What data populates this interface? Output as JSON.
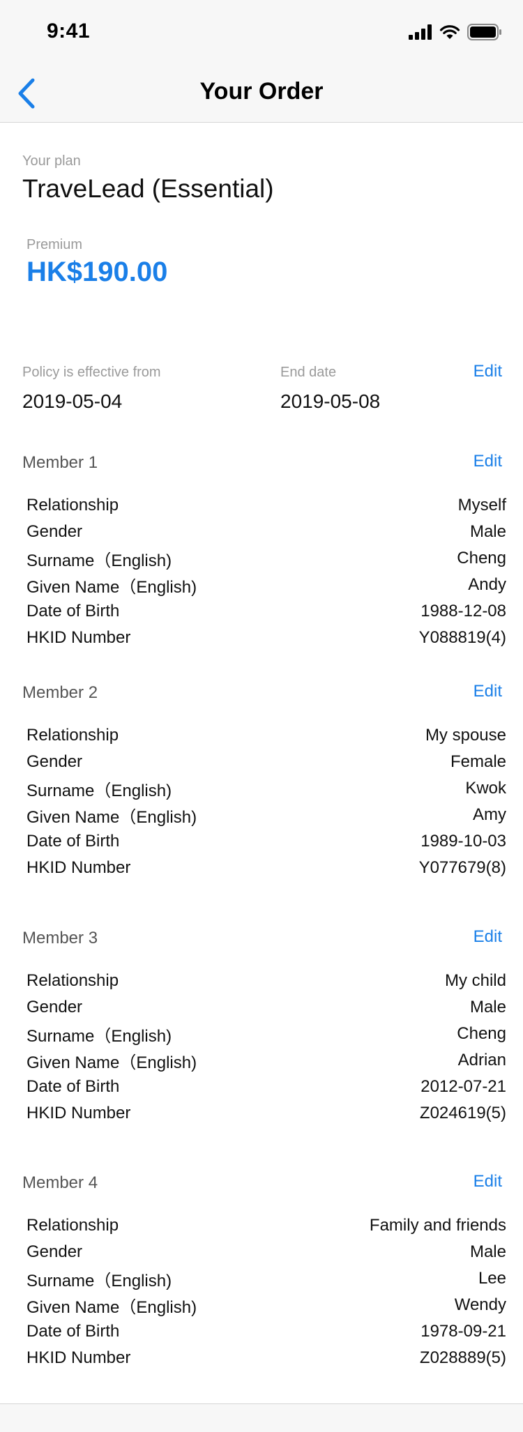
{
  "status_bar": {
    "time": "9:41"
  },
  "nav": {
    "title": "Your Order"
  },
  "plan": {
    "label": "Your plan",
    "name": "TraveLead (Essential)"
  },
  "premium": {
    "label": "Premium",
    "amount": "HK$190.00"
  },
  "dates": {
    "effective_label": "Policy is effective from",
    "effective_value": "2019-05-04",
    "end_label": "End date",
    "end_value": "2019-05-08",
    "edit_label": "Edit"
  },
  "members": [
    {
      "title": "Member 1",
      "edit": "Edit",
      "rows": [
        {
          "label": "Relationship",
          "value": "Myself"
        },
        {
          "label": "Gender",
          "value": "Male"
        },
        {
          "label": "Surname（English)",
          "value": "Cheng"
        },
        {
          "label": "Given Name（English)",
          "value": "Andy"
        },
        {
          "label": "Date of Birth",
          "value": "1988-12-08"
        },
        {
          "label": "HKID Number",
          "value": "Y088819(4)"
        }
      ]
    },
    {
      "title": "Member 2",
      "edit": "Edit",
      "rows": [
        {
          "label": "Relationship",
          "value": "My spouse"
        },
        {
          "label": "Gender",
          "value": "Female"
        },
        {
          "label": "Surname（English)",
          "value": "Kwok"
        },
        {
          "label": "Given Name（English)",
          "value": "Amy"
        },
        {
          "label": "Date of Birth",
          "value": "1989-10-03"
        },
        {
          "label": "HKID Number",
          "value": "Y077679(8)"
        }
      ]
    },
    {
      "title": "Member 3",
      "edit": "Edit",
      "rows": [
        {
          "label": "Relationship",
          "value": "My child"
        },
        {
          "label": "Gender",
          "value": "Male"
        },
        {
          "label": "Surname（English)",
          "value": "Cheng"
        },
        {
          "label": "Given Name（English)",
          "value": "Adrian"
        },
        {
          "label": "Date of Birth",
          "value": "2012-07-21"
        },
        {
          "label": "HKID Number",
          "value": "Z024619(5)"
        }
      ]
    },
    {
      "title": "Member 4",
      "edit": "Edit",
      "rows": [
        {
          "label": "Relationship",
          "value": "Family and friends"
        },
        {
          "label": "Gender",
          "value": "Male"
        },
        {
          "label": "Surname（English)",
          "value": "Lee"
        },
        {
          "label": "Given Name（English)",
          "value": "Wendy"
        },
        {
          "label": "Date of Birth",
          "value": "1978-09-21"
        },
        {
          "label": "HKID Number",
          "value": "Z028889(5)"
        }
      ]
    }
  ],
  "colors": {
    "accent": "#1a7fe8",
    "muted": "#9a9a9a",
    "bar_bg": "#f7f7f7"
  },
  "icons": {
    "back": "chevron-left-icon",
    "signal": "signal-icon",
    "wifi": "wifi-icon",
    "battery": "battery-icon"
  }
}
